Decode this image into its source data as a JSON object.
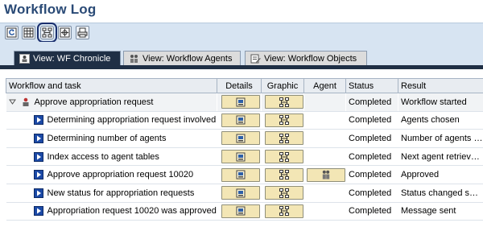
{
  "window": {
    "title": "Workflow Log"
  },
  "toolbar": {
    "buttons": [
      {
        "icon": "refresh-icon"
      },
      {
        "icon": "table-icon"
      },
      {
        "icon": "graphic-icon"
      },
      {
        "icon": "settings-icon"
      },
      {
        "icon": "print-icon"
      }
    ]
  },
  "tabs": [
    {
      "label": "View: WF Chronicle",
      "icon": "chronicle-icon",
      "selected": true
    },
    {
      "label": "View: Workflow Agents",
      "icon": "agents-icon",
      "selected": false
    },
    {
      "label": "View: Workflow Objects",
      "icon": "objects-icon",
      "selected": false
    }
  ],
  "table": {
    "columns": [
      "Workflow and task",
      "Details",
      "Graphic",
      "Agent",
      "Status",
      "Result"
    ],
    "rows": [
      {
        "task": "Approve appropriation request",
        "status": "Completed",
        "result": "Workflow started",
        "has_agent": false,
        "is_root": true
      },
      {
        "task": "Determining appropriation request involved",
        "status": "Completed",
        "result": "Agents chosen",
        "has_agent": false
      },
      {
        "task": "Determining number of agents",
        "status": "Completed",
        "result": "Number of agents d...",
        "has_agent": false
      },
      {
        "task": "Index access to agent tables",
        "status": "Completed",
        "result": "Next agent retrieved ...",
        "has_agent": false
      },
      {
        "task": "Approve appropriation request 10020",
        "status": "Completed",
        "result": "Approved",
        "has_agent": true
      },
      {
        "task": "New status for appropriation requests",
        "status": "Completed",
        "result": "Status changed suc...",
        "has_agent": false
      },
      {
        "task": "Appropriation request 10020 was approved!",
        "status": "Completed",
        "result": "Message sent",
        "has_agent": false
      }
    ]
  },
  "colors": {
    "title": "#2a4a76",
    "toolbar_bg": "#d7e4f2",
    "tab_selected_bg": "#1f2f45",
    "cell_button_bg": "#f3e6b5"
  }
}
